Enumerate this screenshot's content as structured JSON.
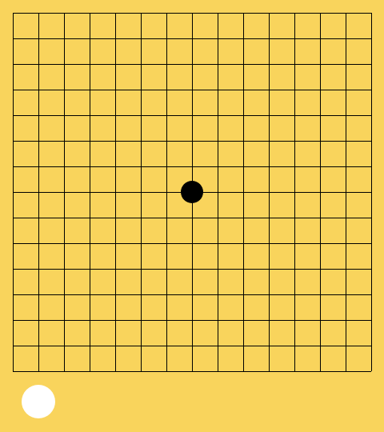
{
  "game": {
    "type": "gomoku",
    "grid_lines": 15,
    "stones": [
      {
        "col": 7,
        "row": 7,
        "color": "black"
      }
    ],
    "current_turn": "white"
  },
  "colors": {
    "background": "#F9D45C",
    "grid_line": "#000000",
    "black_stone": "#000000",
    "white_stone": "#FFFFFF"
  }
}
